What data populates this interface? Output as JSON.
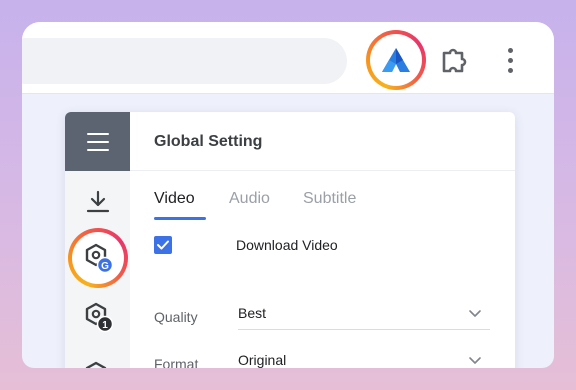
{
  "popup": {
    "title": "Global Setting",
    "tabs": [
      {
        "label": "Video",
        "active": true
      },
      {
        "label": "Audio",
        "active": false
      },
      {
        "label": "Subtitle",
        "active": false
      }
    ],
    "download_video": {
      "label": "Download Video",
      "checked": true
    },
    "quality": {
      "label": "Quality",
      "value": "Best"
    },
    "format": {
      "label": "Format",
      "value": "Original"
    }
  },
  "sidebar": {
    "items": [
      {
        "icon": "hamburger-menu-icon"
      },
      {
        "icon": "download-icon"
      },
      {
        "icon": "hexagon-settings-icon",
        "badge": "G",
        "selected": true
      },
      {
        "icon": "hexagon-settings-icon",
        "badge": "1"
      },
      {
        "icon": "hexagon-settings-icon"
      }
    ]
  },
  "colors": {
    "accent": "#3d72e6",
    "rail_header": "#5b6470",
    "highlight_ring": "#f15a4a"
  }
}
